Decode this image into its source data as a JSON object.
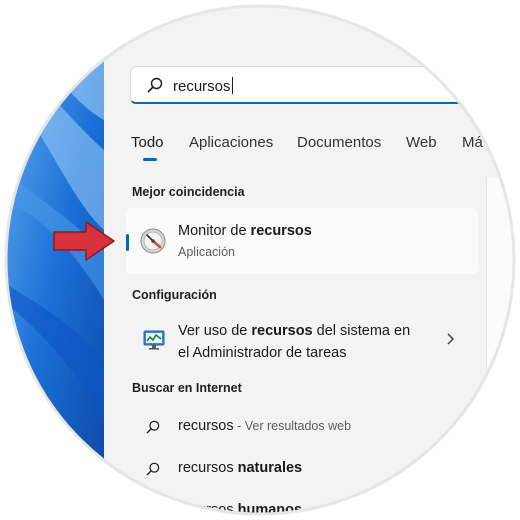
{
  "search": {
    "query": "recursos"
  },
  "tabs": [
    {
      "label": "Todo",
      "active": true
    },
    {
      "label": "Aplicaciones",
      "active": false
    },
    {
      "label": "Documentos",
      "active": false
    },
    {
      "label": "Web",
      "active": false
    },
    {
      "label": "Má",
      "active": false
    }
  ],
  "best_match": {
    "heading": "Mejor coincidencia",
    "title_prefix": "Monitor de ",
    "title_bold": "recursos",
    "subtitle": "Aplicación",
    "icon": "resource-monitor-gauge-icon"
  },
  "settings": {
    "heading": "Configuración",
    "line1_prefix": "Ver uso de ",
    "line1_bold": "recursos",
    "line1_suffix": " del sistema en",
    "line2": "el Administrador de tareas",
    "icon": "monitor-chart-icon"
  },
  "internet": {
    "heading": "Buscar en Internet",
    "items": [
      {
        "prefix": "recursos",
        "bold": "",
        "sub": " - Ver resultados web"
      },
      {
        "prefix": "recursos ",
        "bold": "naturales",
        "sub": ""
      },
      {
        "prefix": "recursos ",
        "bold": "humanos",
        "sub": ""
      }
    ]
  },
  "colors": {
    "accent": "#0067c0",
    "arrow": "#d8323c",
    "panel": "#f3f3f3",
    "wallpaper": "#1a6fd6"
  }
}
